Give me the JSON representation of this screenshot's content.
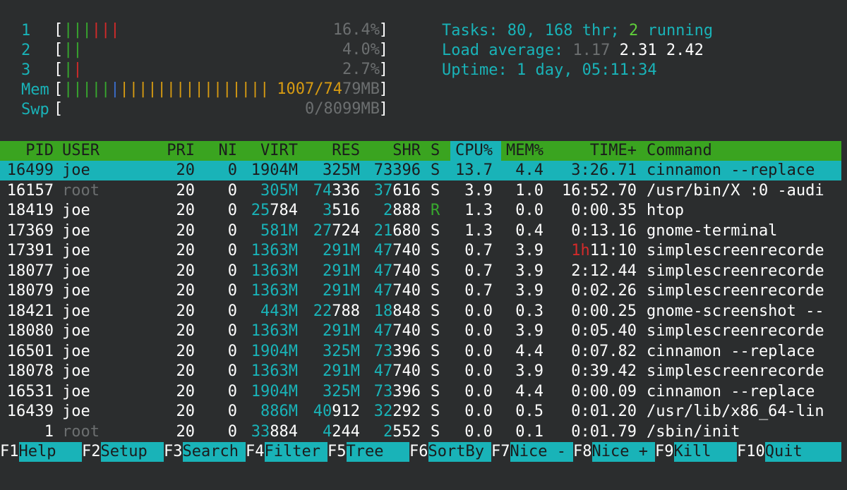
{
  "meters": {
    "cpu": [
      {
        "label": "1",
        "value": "16.4%",
        "bars": [
          {
            "text": "||",
            "color": "green"
          },
          {
            "text": "|",
            "color": "green"
          },
          {
            "text": "|||",
            "color": "red"
          }
        ]
      },
      {
        "label": "2",
        "value": "4.0%",
        "bars": [
          {
            "text": "||",
            "color": "green"
          }
        ]
      },
      {
        "label": "3",
        "value": "2.7%",
        "bars": [
          {
            "text": "|",
            "color": "green"
          },
          {
            "text": "|",
            "color": "red"
          }
        ]
      }
    ],
    "mem": {
      "label": "Mem",
      "value": "1007/7479MB"
    },
    "swp": {
      "label": "Swp",
      "value": "0/8099MB"
    }
  },
  "summary": {
    "tasks_label": "Tasks: ",
    "tasks": "80",
    "threads": "168",
    "thr_label": " thr; ",
    "running": "2",
    "running_label": " running",
    "load_label": "Load average: ",
    "load1": "1.17",
    "load5": "2.31",
    "load15": "2.42",
    "uptime_label": "Uptime: ",
    "uptime": "1 day, 05:11:34"
  },
  "table": {
    "headers": {
      "pid": "PID",
      "user": "USER",
      "pri": "PRI",
      "ni": "NI",
      "virt": "VIRT",
      "res": "RES",
      "shr": "SHR",
      "s": "S",
      "cpu": "CPU%",
      "mem": "MEM%",
      "time": "TIME+",
      "command": "Command"
    },
    "rows": [
      {
        "pid": "16499",
        "user": "joe",
        "pri": "20",
        "ni": "0",
        "virt": "1904M",
        "res": "325M",
        "shr": "73396",
        "s": "S",
        "cpu": "13.7",
        "mem": "4.4",
        "time": "3:26.71",
        "command": "cinnamon --replace"
      },
      {
        "pid": "16157",
        "user": "root",
        "pri": "20",
        "ni": "0",
        "virt": "305M",
        "res": "74336",
        "shr": "37616",
        "s": "S",
        "cpu": "3.9",
        "mem": "1.0",
        "time": "16:52.70",
        "command": "/usr/bin/X :0 -audi"
      },
      {
        "pid": "18419",
        "user": "joe",
        "pri": "20",
        "ni": "0",
        "virt": "25784",
        "res": "3516",
        "shr": "2888",
        "s": "R",
        "cpu": "1.3",
        "mem": "0.0",
        "time": "0:00.35",
        "command": "htop"
      },
      {
        "pid": "17369",
        "user": "joe",
        "pri": "20",
        "ni": "0",
        "virt": "581M",
        "res": "27724",
        "shr": "21680",
        "s": "S",
        "cpu": "1.3",
        "mem": "0.4",
        "time": "0:13.16",
        "command": "gnome-terminal"
      },
      {
        "pid": "17391",
        "user": "joe",
        "pri": "20",
        "ni": "0",
        "virt": "1363M",
        "res": "291M",
        "shr": "47740",
        "s": "S",
        "cpu": "0.7",
        "mem": "3.9",
        "time": "1h11:10",
        "command": "simplescreenrecorde"
      },
      {
        "pid": "18077",
        "user": "joe",
        "pri": "20",
        "ni": "0",
        "virt": "1363M",
        "res": "291M",
        "shr": "47740",
        "s": "S",
        "cpu": "0.7",
        "mem": "3.9",
        "time": "2:12.44",
        "command": "simplescreenrecorde"
      },
      {
        "pid": "18079",
        "user": "joe",
        "pri": "20",
        "ni": "0",
        "virt": "1363M",
        "res": "291M",
        "shr": "47740",
        "s": "S",
        "cpu": "0.7",
        "mem": "3.9",
        "time": "0:02.26",
        "command": "simplescreenrecorde"
      },
      {
        "pid": "18421",
        "user": "joe",
        "pri": "20",
        "ni": "0",
        "virt": "443M",
        "res": "22788",
        "shr": "18848",
        "s": "S",
        "cpu": "0.0",
        "mem": "0.3",
        "time": "0:00.25",
        "command": "gnome-screenshot --"
      },
      {
        "pid": "18080",
        "user": "joe",
        "pri": "20",
        "ni": "0",
        "virt": "1363M",
        "res": "291M",
        "shr": "47740",
        "s": "S",
        "cpu": "0.0",
        "mem": "3.9",
        "time": "0:05.40",
        "command": "simplescreenrecorde"
      },
      {
        "pid": "16501",
        "user": "joe",
        "pri": "20",
        "ni": "0",
        "virt": "1904M",
        "res": "325M",
        "shr": "73396",
        "s": "S",
        "cpu": "0.0",
        "mem": "4.4",
        "time": "0:07.82",
        "command": "cinnamon --replace"
      },
      {
        "pid": "18078",
        "user": "joe",
        "pri": "20",
        "ni": "0",
        "virt": "1363M",
        "res": "291M",
        "shr": "47740",
        "s": "S",
        "cpu": "0.0",
        "mem": "3.9",
        "time": "0:39.42",
        "command": "simplescreenrecorde"
      },
      {
        "pid": "16531",
        "user": "joe",
        "pri": "20",
        "ni": "0",
        "virt": "1904M",
        "res": "325M",
        "shr": "73396",
        "s": "S",
        "cpu": "0.0",
        "mem": "4.4",
        "time": "0:00.09",
        "command": "cinnamon --replace"
      },
      {
        "pid": "16439",
        "user": "joe",
        "pri": "20",
        "ni": "0",
        "virt": "886M",
        "res": "40912",
        "shr": "32292",
        "s": "S",
        "cpu": "0.0",
        "mem": "0.5",
        "time": "0:01.20",
        "command": "/usr/lib/x86_64-lin"
      },
      {
        "pid": "1",
        "user": "root",
        "pri": "20",
        "ni": "0",
        "virt": "33884",
        "res": "4244",
        "shr": "2552",
        "s": "S",
        "cpu": "0.0",
        "mem": "0.1",
        "time": "0:01.79",
        "command": "/sbin/init"
      }
    ]
  },
  "fkeys": [
    {
      "key": "F1",
      "label": "Help"
    },
    {
      "key": "F2",
      "label": "Setup"
    },
    {
      "key": "F3",
      "label": "Search"
    },
    {
      "key": "F4",
      "label": "Filter"
    },
    {
      "key": "F5",
      "label": "Tree"
    },
    {
      "key": "F6",
      "label": "SortBy"
    },
    {
      "key": "F7",
      "label": "Nice -"
    },
    {
      "key": "F8",
      "label": "Nice +"
    },
    {
      "key": "F9",
      "label": "Kill"
    },
    {
      "key": "F10",
      "label": "Quit"
    }
  ],
  "colors": {
    "background": "#2b2d2e",
    "cyan": "#19b3b8",
    "green": "#3aa420",
    "red": "#d42a2a",
    "orange": "#d79b12",
    "gray": "#6c6f70"
  }
}
